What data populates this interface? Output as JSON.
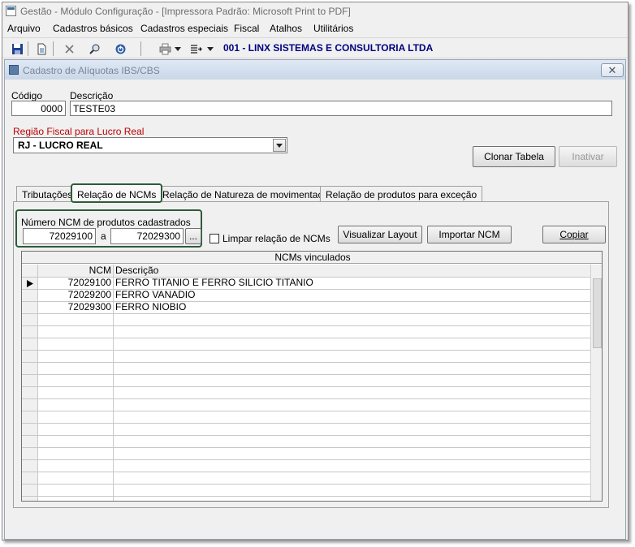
{
  "window": {
    "title": "Gestão  - Módulo Configuração - [Impressora Padrão: Microsoft Print to PDF]"
  },
  "menu": [
    "Arquivo",
    "Cadastros básicos",
    "Cadastros especiais",
    "Fiscal",
    "Atalhos",
    "Utilitários"
  ],
  "toolbar": {
    "company": "001 - LINX SISTEMAS E CONSULTORIA LTDA"
  },
  "form": {
    "title": "Cadastro de Alíquotas IBS/CBS",
    "close_label": "✕",
    "codigo_label": "Código",
    "codigo_value": "0000",
    "descricao_label": "Descrição",
    "descricao_value": "TESTE03",
    "regiao_label": "Região Fiscal para Lucro Real",
    "regiao_value": "RJ - LUCRO REAL",
    "clonar_label": "Clonar Tabela",
    "inativar_label": "Inativar",
    "tabs": [
      "Tributações",
      "Relação de NCMs",
      "Relação de Natureza de movimentação",
      "Relação de produtos para exceção"
    ],
    "numero_label": "Número  NCM de produtos cadastrados",
    "ncm_from": "72029100",
    "range_sep": "a",
    "ncm_to": "72029300",
    "browse_label": "...",
    "limpar_label": "Limpar relação de NCMs",
    "visualizar_label": "Visualizar Layout",
    "importar_label": "Importar NCM",
    "copiar_label": "Copiar",
    "grid": {
      "caption": "NCMs vinculados",
      "col_ncm": "NCM",
      "col_desc": "Descrição",
      "rows": [
        {
          "ncm": "72029100",
          "desc": "FERRO TITANIO E FERRO SILICIO TITANIO"
        },
        {
          "ncm": "72029200",
          "desc": "FERRO VANADIO"
        },
        {
          "ncm": "72029300",
          "desc": "FERRO NIOBIO"
        }
      ]
    }
  }
}
